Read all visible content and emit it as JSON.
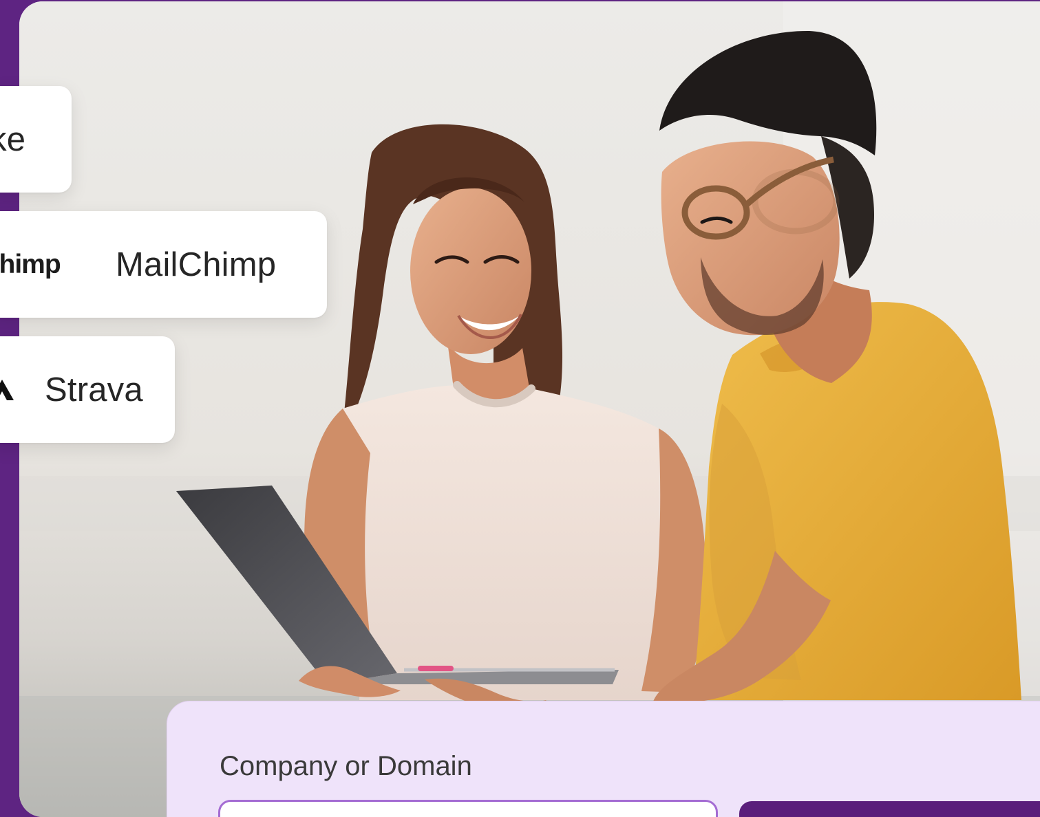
{
  "integrations": [
    {
      "label": "ike"
    },
    {
      "logo_text": "lchimp",
      "label": "MailChimp"
    },
    {
      "icon": "strava-icon",
      "label": "Strava"
    }
  ],
  "form": {
    "label": "Company or Domain",
    "input_value": "",
    "button_label": ""
  },
  "colors": {
    "brand_purple": "#5e2482",
    "form_background": "#efe3fa",
    "input_border": "#a46cd3",
    "button_background": "#5a1e7b"
  }
}
